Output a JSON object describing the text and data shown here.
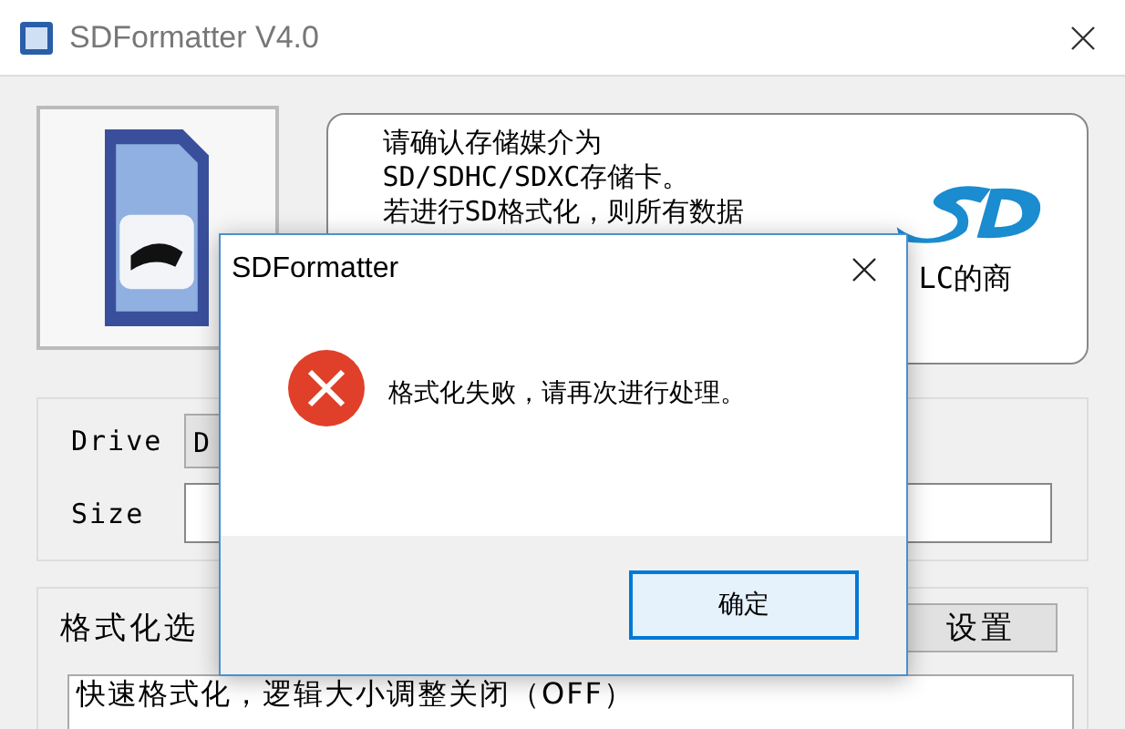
{
  "window": {
    "title": "SDFormatter V4.0"
  },
  "info_panel": {
    "lines": [
      "请确认存储媒介为",
      "SD/SDHC/SDXC存储卡。",
      "若进行SD格式化，则所有数据"
    ],
    "line_4": "LC的商"
  },
  "drive": {
    "label": "Drive",
    "value": "D"
  },
  "size": {
    "label": "Size"
  },
  "options": {
    "label": "格式化选",
    "button": "设置",
    "value": "快速格式化，逻辑大小调整关闭（OFF）"
  },
  "dialog": {
    "title": "SDFormatter",
    "kind": "error",
    "message": "格式化失败，请再次进行处理。",
    "buttons": [
      {
        "label": "确定",
        "selected": true
      }
    ]
  }
}
